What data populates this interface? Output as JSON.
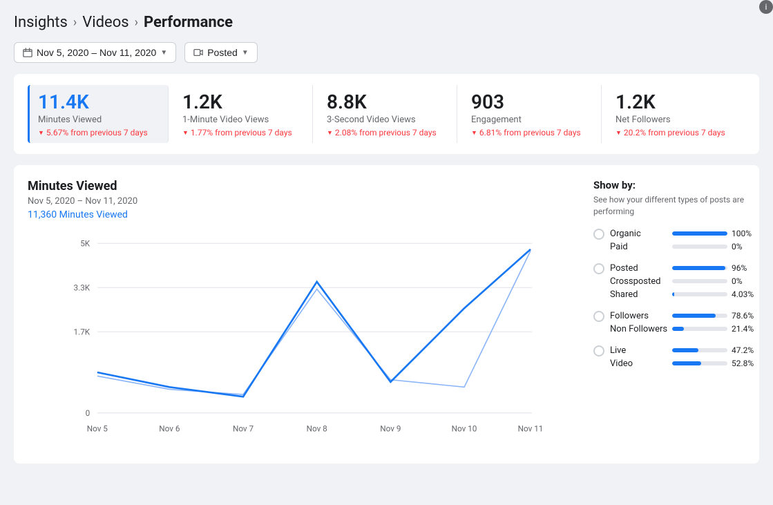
{
  "breadcrumb": {
    "link1": "Insights",
    "sep1": "›",
    "link2": "Videos",
    "sep2": "›",
    "current": "Performance"
  },
  "filters": {
    "date_range": "Nov 5, 2020 – Nov 11, 2020",
    "posted_label": "Posted"
  },
  "metrics": [
    {
      "value": "11.4K",
      "label": "Minutes Viewed",
      "change": "5.67% from previous 7 days",
      "active": true
    },
    {
      "value": "1.2K",
      "label": "1-Minute Video Views",
      "change": "1.77% from previous 7 days",
      "active": false
    },
    {
      "value": "8.8K",
      "label": "3-Second Video Views",
      "change": "2.08% from previous 7 days",
      "active": false
    },
    {
      "value": "903",
      "label": "Engagement",
      "change": "6.81% from previous 7 days",
      "active": false
    },
    {
      "value": "1.2K",
      "label": "Net Followers",
      "change": "20.2% from previous 7 days",
      "active": false
    }
  ],
  "chart": {
    "title": "Minutes Viewed",
    "date_range": "Nov 5, 2020 – Nov 11, 2020",
    "subtitle_number": "11,360",
    "subtitle_label": "Minutes Viewed",
    "y_labels": [
      "5K",
      "3.3K",
      "1.7K",
      "0"
    ],
    "x_labels": [
      "Nov 5",
      "Nov 6",
      "Nov 7",
      "Nov 8",
      "Nov 9",
      "Nov 10",
      "Nov 11"
    ]
  },
  "show_by": {
    "title": "Show by:",
    "description": "See how your different types of posts are performing",
    "groups": [
      {
        "rows": [
          {
            "label": "Organic",
            "pct": "100%",
            "fill": 100,
            "type": "dark"
          },
          {
            "label": "Paid",
            "pct": "0%",
            "fill": 0,
            "type": "light"
          }
        ]
      },
      {
        "rows": [
          {
            "label": "Posted",
            "pct": "96%",
            "fill": 96,
            "type": "dark"
          },
          {
            "label": "Crossposted",
            "pct": "0%",
            "fill": 0,
            "type": "light"
          },
          {
            "label": "Shared",
            "pct": "4.03%",
            "fill": 4,
            "type": "tiny"
          }
        ]
      },
      {
        "rows": [
          {
            "label": "Followers",
            "pct": "78.6%",
            "fill": 79,
            "type": "dark"
          },
          {
            "label": "Non Followers",
            "pct": "21.4%",
            "fill": 21,
            "type": "dark"
          }
        ]
      },
      {
        "rows": [
          {
            "label": "Live",
            "pct": "47.2%",
            "fill": 47,
            "type": "dark"
          },
          {
            "label": "Video",
            "pct": "52.8%",
            "fill": 53,
            "type": "dark"
          }
        ]
      }
    ]
  }
}
